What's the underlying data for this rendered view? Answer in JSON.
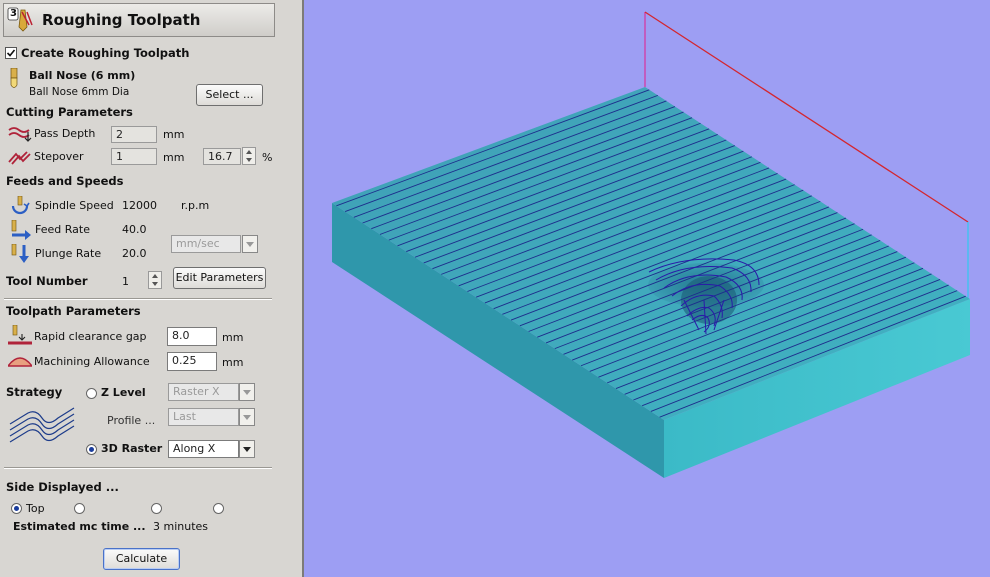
{
  "panel": {
    "title": "Roughing Toolpath",
    "title_icon_number": "3",
    "create_checkbox": {
      "label": "Create Roughing Toolpath",
      "checked": true
    },
    "tool": {
      "name": "Ball Nose (6 mm)",
      "description": "Ball Nose 6mm Dia",
      "select_label": "Select ..."
    },
    "cutting": {
      "heading": "Cutting Parameters",
      "pass_depth": {
        "label": "Pass Depth",
        "value": "2",
        "unit": "mm"
      },
      "stepover": {
        "label": "Stepover",
        "value": "1",
        "unit": "mm",
        "percent_value": "16.7",
        "percent_unit": "%"
      }
    },
    "feeds": {
      "heading": "Feeds and Speeds",
      "spindle": {
        "label": "Spindle Speed",
        "value": "12000",
        "unit": "r.p.m"
      },
      "feed": {
        "label": "Feed Rate",
        "value": "40.0"
      },
      "plunge": {
        "label": "Plunge Rate",
        "value": "20.0"
      },
      "rate_units": "mm/sec",
      "tool_number": {
        "label": "Tool Number",
        "value": "1"
      },
      "edit_label": "Edit Parameters"
    },
    "toolpath_params": {
      "heading": "Toolpath Parameters",
      "rapid": {
        "label": "Rapid clearance gap",
        "value": "8.0",
        "unit": "mm"
      },
      "allowance": {
        "label": "Machining Allowance",
        "value": "0.25",
        "unit": "mm"
      }
    },
    "strategy": {
      "label": "Strategy",
      "zlevel": {
        "label": "Z Level",
        "selected": false,
        "option": "Raster X"
      },
      "profile": {
        "label": "Profile ...",
        "option": "Last"
      },
      "raster3d": {
        "label": "3D Raster",
        "selected": true,
        "option": "Along X"
      }
    },
    "side": {
      "heading": "Side Displayed ...",
      "options": [
        "Top",
        "",
        "",
        ""
      ],
      "selected_index": 0
    },
    "estimate": {
      "label": "Estimated mc time ...",
      "value": "3 minutes"
    },
    "calculate_label": "Calculate"
  },
  "viewport": {
    "background": "#9d9ef3",
    "block_top_color": "#3ea8b8",
    "block_front_color": "#3ab7c4",
    "block_side_color": "#2d8fa2",
    "toolpath_color": "#1d2d8c",
    "bbox_red": "#d4262e",
    "bbox_magenta": "#d43aa4",
    "bbox_cyan": "#38c6f0",
    "raster_pass_count": 38
  }
}
